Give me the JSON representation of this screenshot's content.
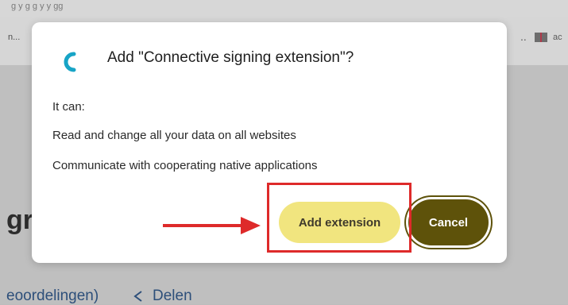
{
  "dialog": {
    "title": "Add \"Connective signing extension\"?",
    "permissions_heading": "It can:",
    "permission_1": "Read and change all your data on all websites",
    "permission_2": "Communicate with cooperating native applications",
    "add_button_label": "Add extension",
    "cancel_button_label": "Cancel",
    "logo_color": "#17a4c6"
  },
  "background": {
    "top_truncated_text": "g              y       g        g     y         y  gg",
    "bookmarks_left_text": "n...",
    "bookmarks_right_dots": "..",
    "bookmarks_right_text": "ac",
    "page_heading_stub": "gr",
    "bottom_link_text": "eoordelingen)",
    "share_label": "Delen"
  },
  "annotation": {
    "highlight_color": "#de2a2a",
    "arrow_color": "#de2a2a"
  },
  "icons": {
    "extension_logo": "connective-logo-icon",
    "bookmark_icon": "book-icon",
    "share_icon": "share-icon"
  }
}
